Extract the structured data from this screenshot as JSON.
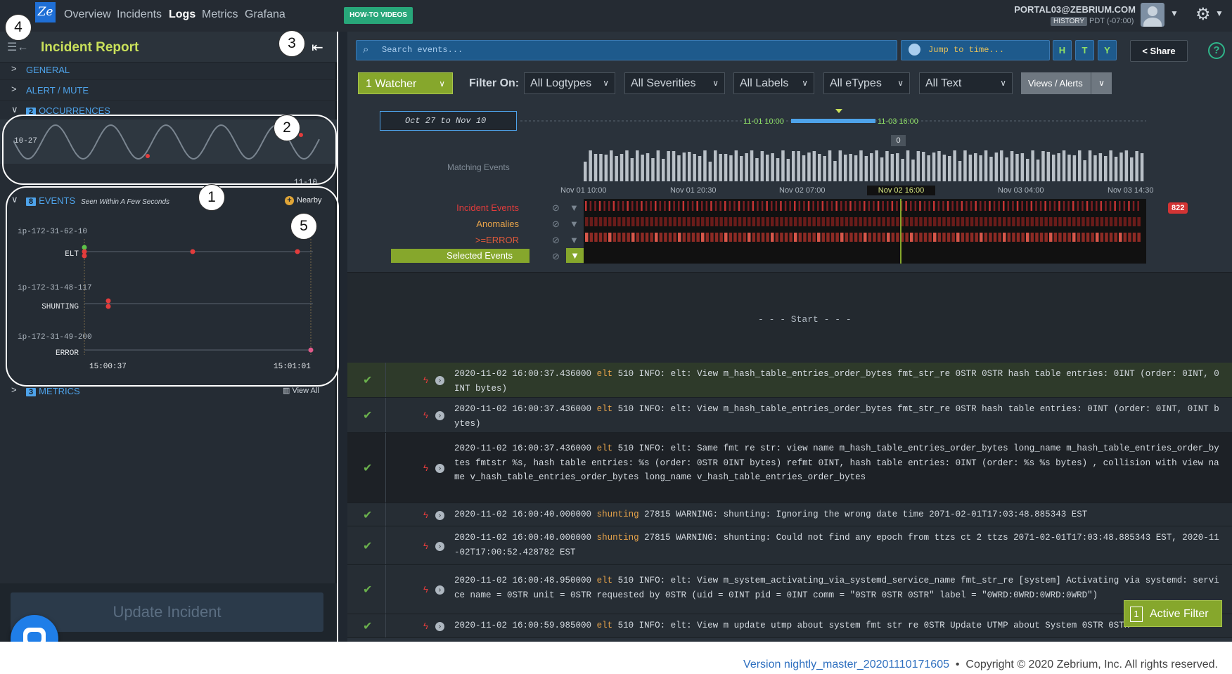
{
  "nav": {
    "logo": "Ze",
    "items": [
      "Overview",
      "Incidents",
      "Logs",
      "Metrics",
      "Grafana"
    ],
    "active": "Logs",
    "howto": "HOW-TO VIDEOS",
    "user": "PORTAL03@ZEBRIUM.COM",
    "history": "HISTORY",
    "tz": "PDT (-07:00)"
  },
  "left": {
    "title": "Incident Report",
    "sections": {
      "general": "GENERAL",
      "alert": "ALERT / MUTE",
      "occurrences": "OCCURRENCES",
      "occ_count": "2",
      "events": "EVENTS",
      "events_count": "8",
      "events_sub": "Seen Within A Few Seconds",
      "nearby": "Nearby",
      "metrics": "METRICS",
      "metrics_count": "3",
      "view_all": "View All"
    },
    "occ_start": "10-27",
    "occ_end": "11-10",
    "hosts": [
      "ip-172-31-62-10",
      "ip-172-31-48-117",
      "ip-172-31-49-200"
    ],
    "rows": [
      "ELT",
      "SHUNTING",
      "ERROR"
    ],
    "time_start": "15:00:37",
    "time_end": "15:01:01",
    "update": "Update Incident"
  },
  "toolbar": {
    "search": "Search events...",
    "jump": "Jump to time...",
    "h": "H",
    "t": "T",
    "y": "Y",
    "share": "Share",
    "help": "?",
    "watcher": "1 Watcher",
    "filter_on": "Filter On:",
    "filters": [
      "All Logtypes",
      "All Severities",
      "All Labels",
      "All eTypes",
      "All Text"
    ],
    "views": "Views / Alerts"
  },
  "timeline": {
    "range": "Oct 27 to Nov 10",
    "range_left": "11-01 10:00",
    "range_right": "11-03 16:00",
    "matching": "Matching Events",
    "bottom": "0",
    "axis": [
      "Nov 01 10:00",
      "Nov 01 20:30",
      "Nov 02 07:00",
      "Nov 02 16:00",
      "Nov 03 04:00",
      "Nov 03 14:30"
    ],
    "rows": [
      "Incident Events",
      "Anomalies",
      ">=ERROR",
      "Selected Events"
    ],
    "badge": "822"
  },
  "logs": {
    "start": "- - - Start - - -",
    "entries": [
      {
        "ts": "2020-11-02 16:00:37.436000",
        "src": "elt",
        "msg": "510 INFO: elt:  View m_hash_table_entries_order_bytes fmt_str_re 0STR 0STR hash table entries: 0INT (order: 0INT, 0INT bytes)"
      },
      {
        "ts": "2020-11-02 16:00:37.436000",
        "src": "elt",
        "msg": "510 INFO: elt:  View m_hash_table_entries_order_bytes fmt_str_re 0STR hash table entries: 0INT (order: 0INT, 0INT bytes)"
      },
      {
        "ts": "2020-11-02 16:00:37.436000",
        "src": "elt",
        "msg": "510 INFO: elt:  Same fmt re str: view name m_hash_table_entries_order_bytes long_name m_hash_table_entries_order_bytes fmtstr %s, hash table entries: %s (order: 0STR 0INT bytes) refmt 0INT, hash table entries: 0INT (order: %s %s bytes) , collision with view name v_hash_table_entries_order_bytes long_name v_hash_table_entries_order_bytes"
      },
      {
        "ts": "2020-11-02 16:00:40.000000",
        "src": "shunting",
        "msg": "27815 WARNING: shunting: Ignoring the wrong date time 2071-02-01T17:03:48.885343 EST"
      },
      {
        "ts": "2020-11-02 16:00:40.000000",
        "src": "shunting",
        "msg": "27815 WARNING: shunting: Could not find any epoch from ttzs ct 2 ttzs 2071-02-01T17:03:48.885343 EST, 2020-11-02T17:00:52.428782 EST"
      },
      {
        "ts": "2020-11-02 16:00:48.950000",
        "src": "elt",
        "msg": "510 INFO: elt:  View m_system_activating_via_systemd_service_name fmt_str_re [system] Activating via systemd: service name = 0STR unit = 0STR requested by 0STR (uid = 0INT pid = 0INT comm = \"0STR 0STR 0STR\" label = \"0WRD:0WRD:0WRD:0WRD\")"
      },
      {
        "ts": "2020-11-02 16:00:59.985000",
        "src": "elt",
        "msg": "510 INFO: elt:  View m update utmp about system fmt str re 0STR Update UTMP about System 0STR 0STR"
      }
    ]
  },
  "active_filter": {
    "count": "1",
    "label": "Active Filter"
  },
  "footer": {
    "version": "Version nightly_master_20201110171605",
    "copyright": "Copyright © 2020 Zebrium, Inc. All rights reserved."
  },
  "callouts": [
    "4",
    "3",
    "2",
    "1",
    "5"
  ],
  "colors": {
    "accent": "#c9e05a",
    "link": "#4ea3ea",
    "green": "#86a72c",
    "red": "#d33434"
  }
}
